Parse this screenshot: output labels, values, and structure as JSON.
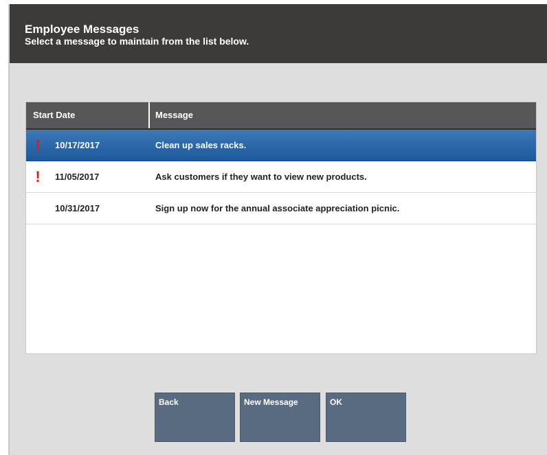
{
  "header": {
    "title": "Employee Messages",
    "subtitle": "Select a message to maintain from the list below."
  },
  "table": {
    "columns": [
      "Start Date",
      "Message"
    ],
    "rows": [
      {
        "alert": "!",
        "start_date": "10/17/2017",
        "message": "Clean up sales racks.",
        "selected": true
      },
      {
        "alert": "!",
        "start_date": "11/05/2017",
        "message": "Ask customers if they want to view new products.",
        "selected": false
      },
      {
        "alert": "",
        "start_date": "10/31/2017",
        "message": "Sign up now for the annual associate appreciation picnic.",
        "selected": false
      }
    ]
  },
  "buttons": {
    "back": "Back",
    "new_message": "New Message",
    "ok": "OK"
  },
  "colors": {
    "header_bg": "#3c3b39",
    "selected_row": "#2a67aa",
    "button_bg": "#596b80",
    "alert": "#d42020"
  }
}
